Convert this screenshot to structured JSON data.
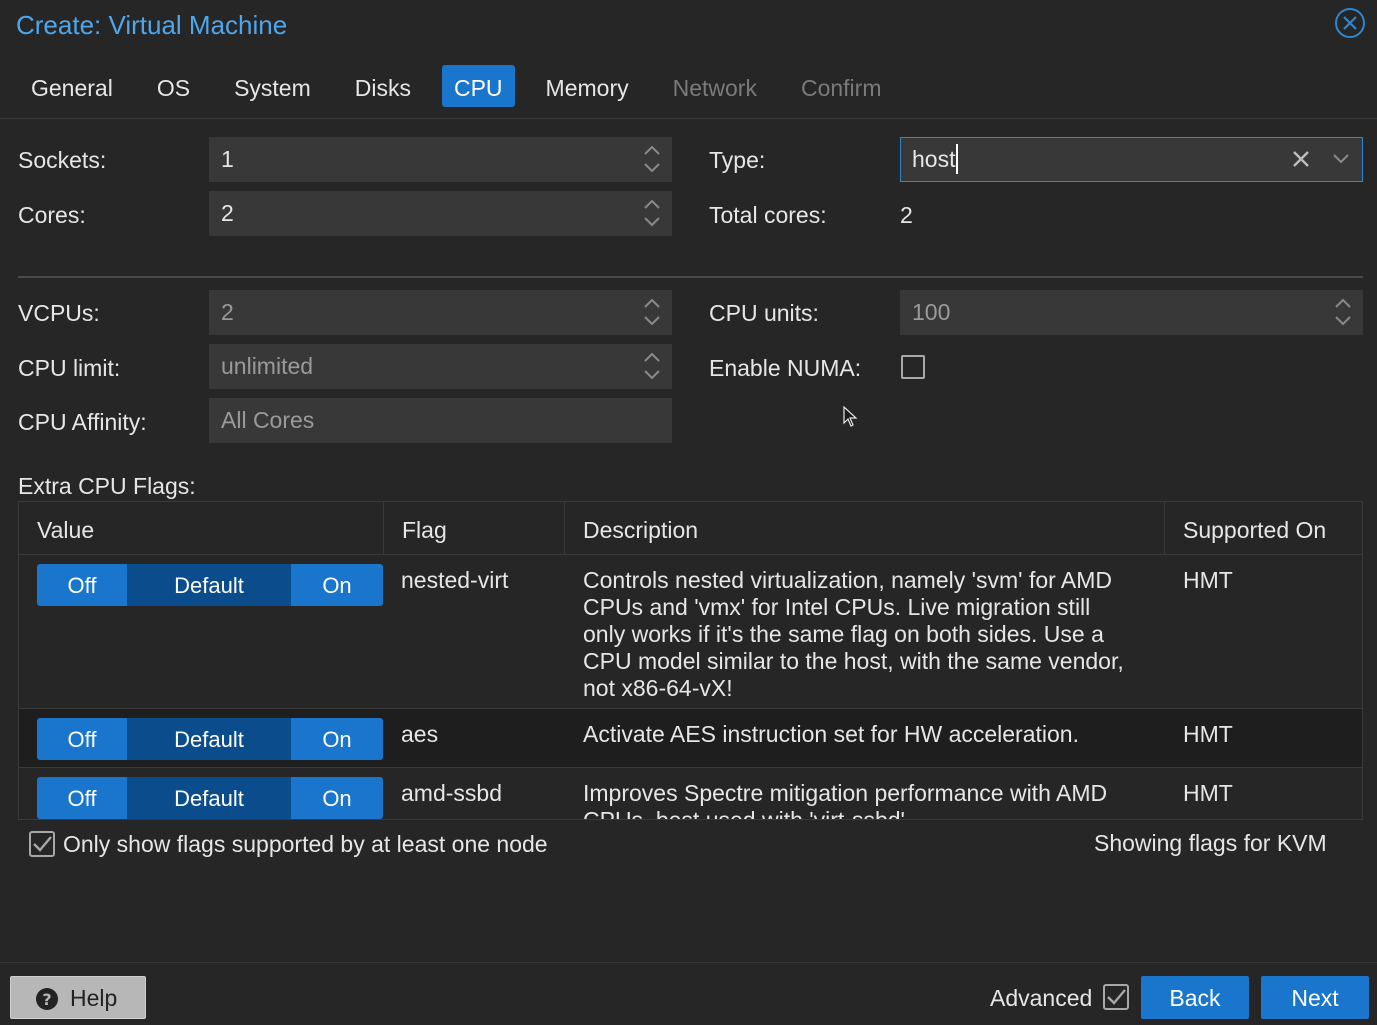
{
  "window": {
    "title": "Create: Virtual Machine"
  },
  "tabs": [
    {
      "label": "General"
    },
    {
      "label": "OS"
    },
    {
      "label": "System"
    },
    {
      "label": "Disks"
    },
    {
      "label": "CPU"
    },
    {
      "label": "Memory"
    },
    {
      "label": "Network"
    },
    {
      "label": "Confirm"
    }
  ],
  "form": {
    "sockets": {
      "label": "Sockets:",
      "value": "1"
    },
    "cores": {
      "label": "Cores:",
      "value": "2"
    },
    "type": {
      "label": "Type:",
      "value": "host"
    },
    "total_cores": {
      "label": "Total cores:",
      "value": "2"
    },
    "vcpus": {
      "label": "VCPUs:",
      "value": "2"
    },
    "cpu_units": {
      "label": "CPU units:",
      "value": "100"
    },
    "cpu_limit": {
      "label": "CPU limit:",
      "value": "unlimited"
    },
    "numa": {
      "label": "Enable NUMA:",
      "checked": false
    },
    "affinity": {
      "label": "CPU Affinity:",
      "placeholder": "All Cores"
    }
  },
  "flags": {
    "section_label": "Extra CPU Flags:",
    "columns": [
      "Value",
      "Flag",
      "Description",
      "Supported On"
    ],
    "toggle_labels": {
      "off": "Off",
      "default": "Default",
      "on": "On"
    },
    "rows": [
      {
        "flag": "nested-virt",
        "description_lines": [
          "Controls nested virtualization, namely 'svm' for AMD",
          "CPUs and 'vmx' for Intel CPUs. Live migration still",
          "only works if it's the same flag on both sides. Use a",
          "CPU model similar to the host, with the same vendor,",
          "not x86-64-vX!"
        ],
        "supported": "HMT"
      },
      {
        "flag": "aes",
        "description_lines": [
          "Activate AES instruction set for HW acceleration."
        ],
        "supported": "HMT"
      },
      {
        "flag": "amd-ssbd",
        "description_lines": [
          "Improves Spectre mitigation performance with AMD",
          "CPUs, best used with 'virt-ssbd'"
        ],
        "supported": "HMT"
      }
    ],
    "only_supported": {
      "label": "Only show flags supported by at least one node",
      "checked": true
    },
    "showing_for": "Showing flags for KVM"
  },
  "footer": {
    "help": "Help",
    "advanced": "Advanced",
    "back": "Back",
    "next": "Next"
  }
}
